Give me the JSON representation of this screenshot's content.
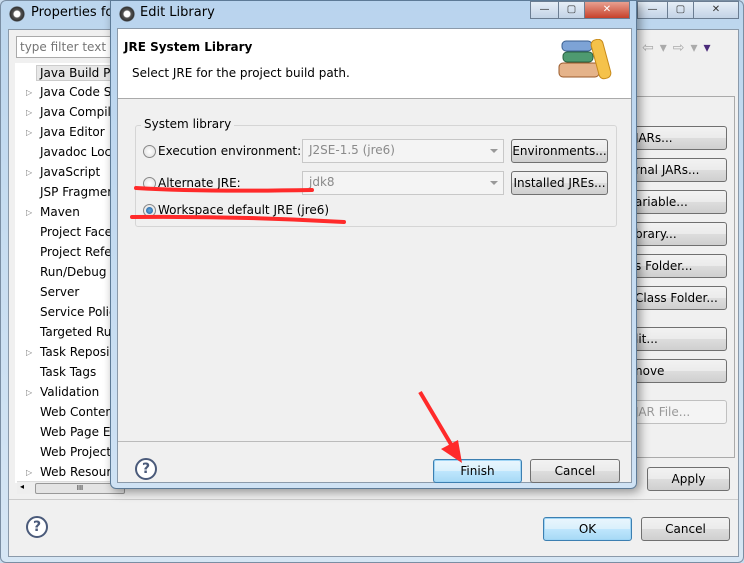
{
  "properties_window": {
    "title": "Properties for",
    "filter_placeholder": "type filter text",
    "tree": [
      {
        "label": "Java Build Pa",
        "expandable": false,
        "selected": true
      },
      {
        "label": "Java Code S",
        "expandable": true
      },
      {
        "label": "Java Compil",
        "expandable": true
      },
      {
        "label": "Java Editor",
        "expandable": true
      },
      {
        "label": "Javadoc Loc",
        "expandable": false
      },
      {
        "label": "JavaScript",
        "expandable": true
      },
      {
        "label": "JSP Fragmer",
        "expandable": false
      },
      {
        "label": "Maven",
        "expandable": true
      },
      {
        "label": "Project Face",
        "expandable": false
      },
      {
        "label": "Project Refe",
        "expandable": false
      },
      {
        "label": "Run/Debug",
        "expandable": false
      },
      {
        "label": "Server",
        "expandable": false
      },
      {
        "label": "Service Polic",
        "expandable": false
      },
      {
        "label": "Targeted Ru",
        "expandable": false
      },
      {
        "label": "Task Reposi",
        "expandable": true
      },
      {
        "label": "Task Tags",
        "expandable": false
      },
      {
        "label": "Validation",
        "expandable": true
      },
      {
        "label": "Web Conten",
        "expandable": false
      },
      {
        "label": "Web Page E",
        "expandable": false
      },
      {
        "label": "Web Project",
        "expandable": false
      },
      {
        "label": "Web Resour",
        "expandable": true
      }
    ],
    "side_buttons": [
      {
        "label": "JARs...",
        "enabled": true
      },
      {
        "label": "rnal JARs...",
        "enabled": true
      },
      {
        "label": "ariable...",
        "enabled": true
      },
      {
        "label": "brary...",
        "enabled": true
      },
      {
        "label": "s Folder...",
        "enabled": true
      },
      {
        "label": "Class Folder...",
        "enabled": true
      },
      {
        "label": "lit...",
        "enabled": true
      },
      {
        "label": "nove",
        "enabled": true
      },
      {
        "label": "JAR File...",
        "enabled": false
      }
    ],
    "scrollbar_grip": "III",
    "apply_label": "Apply",
    "ok_label": "OK",
    "cancel_label": "Cancel",
    "help_label": "?",
    "window_buttons": {
      "minimize": "—",
      "maximize": "▢",
      "close": "✕"
    }
  },
  "dialog": {
    "title": "Edit Library",
    "header_title": "JRE System Library",
    "header_desc": "Select JRE for the project build path.",
    "group_label": "System library",
    "options": [
      {
        "label": "Execution environment:",
        "value": "J2SE-1.5 (jre6)",
        "button": "Environments...",
        "selected": false
      },
      {
        "label": "Alternate JRE:",
        "value": "jdk8",
        "button": "Installed JREs...",
        "selected": false
      },
      {
        "label": "Workspace default JRE (jre6)",
        "selected": true
      }
    ],
    "finish_label": "Finish",
    "cancel_label": "Cancel",
    "help_label": "?",
    "window_buttons": {
      "minimize": "—",
      "maximize": "▢",
      "close": "✕"
    }
  },
  "colors": {
    "annotation": "#ff2a2a",
    "accent": "#3c7fb1"
  }
}
